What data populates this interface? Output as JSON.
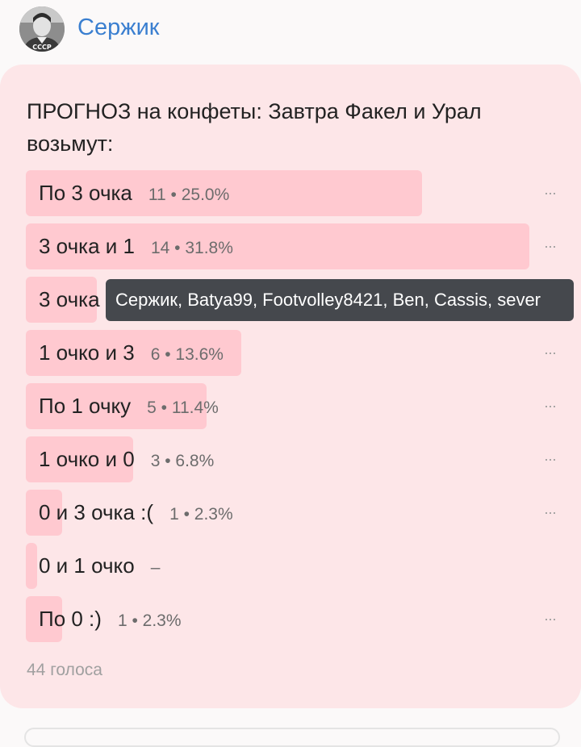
{
  "author": {
    "name": "Сержик",
    "avatar_icon": "user-photo-avatar",
    "avatar_text": "СССР"
  },
  "poll": {
    "question": "ПРОГНОЗ на конфеты: Завтра Факел и Урал возьмут:",
    "options": [
      {
        "label": "По 3 очка",
        "stat": "11 • 25.0%",
        "share": 0.25
      },
      {
        "label": "3 очка и 1",
        "stat": "14 • 31.8%",
        "share": 0.318
      },
      {
        "label": "3 очка",
        "stat": "",
        "share": 0.045
      },
      {
        "label": "1 очко и 3",
        "stat": "6 • 13.6%",
        "share": 0.136
      },
      {
        "label": "По 1 очку",
        "stat": "5 • 11.4%",
        "share": 0.114
      },
      {
        "label": "1 очко и 0",
        "stat": "3 • 6.8%",
        "share": 0.068
      },
      {
        "label": "0 и 3 очка :(",
        "stat": "1 • 2.3%",
        "share": 0.023
      },
      {
        "label": "0 и 1 очко",
        "stat": "–",
        "share": 0
      },
      {
        "label": "По 0 :)",
        "stat": "1 • 2.3%",
        "share": 0.023
      }
    ],
    "more_icon": "ellipsis-icon",
    "more_label": "···",
    "tooltip": "Сержик, Batya99, Footvolley8421, Ben, Cassis, sever",
    "total": "44 голоса"
  },
  "colors": {
    "card": "#fde6e8",
    "bar": "#ffc9d0",
    "author": "#3a7fd0",
    "tooltip": "#45484d"
  }
}
